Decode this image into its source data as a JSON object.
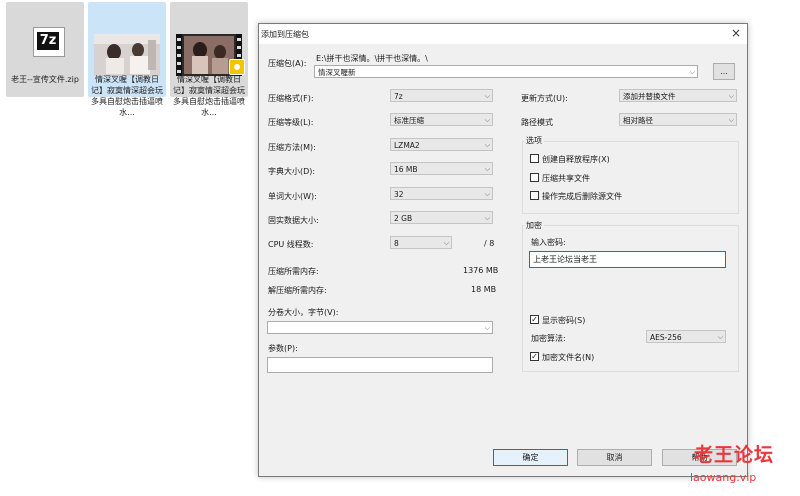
{
  "desktop": {
    "items": [
      {
        "label": "老王--宣传文件.zip",
        "icon": "7z-archive-icon"
      },
      {
        "label": "情深叉喔【调教日记】寂寞情深超会玩 多具自慰炮击插逼喷水...",
        "icon": "video-thumbnail"
      },
      {
        "label": "情深叉喔【调教日记】寂寞情深超会玩 多具自慰炮击插逼喷水...",
        "icon": "video-thumbnail"
      }
    ]
  },
  "dialog": {
    "title": "添加到压缩包",
    "close_icon": "×",
    "archive": {
      "label": "压缩包(A):",
      "path": "E:\\拼干也深情。\\拼干也深情。\\",
      "value": "情深叉喔新",
      "browse_label": "..."
    },
    "format": {
      "label": "压缩格式(F):",
      "value": "7z"
    },
    "level": {
      "label": "压缩等级(L):",
      "value": "标准压缩"
    },
    "method": {
      "label": "压缩方法(M):",
      "value": "LZMA2"
    },
    "dict": {
      "label": "字典大小(D):",
      "value": "16 MB"
    },
    "word": {
      "label": "单词大小(W):",
      "value": "32"
    },
    "solid": {
      "label": "固实数据大小:",
      "value": "2 GB"
    },
    "cpu": {
      "label": "CPU 线程数:",
      "value": "8",
      "total": "/ 8"
    },
    "mem_comp": {
      "label": "压缩所需内存:",
      "value": "1376 MB"
    },
    "mem_decomp": {
      "label": "解压缩所需内存:",
      "value": "18 MB"
    },
    "split": {
      "label": "分卷大小，字节(V):",
      "value": ""
    },
    "params": {
      "label": "参数(P):",
      "value": ""
    },
    "update": {
      "label": "更新方式(U):",
      "value": "添加并替换文件"
    },
    "path_mode": {
      "label": "路径模式",
      "value": "相对路径"
    },
    "options": {
      "title": "选项",
      "items": [
        {
          "label": "创建自释放程序(X)",
          "checked": false
        },
        {
          "label": "压缩共享文件",
          "checked": false
        },
        {
          "label": "操作完成后删除源文件",
          "checked": false
        }
      ]
    },
    "encryption": {
      "title": "加密",
      "password_label": "输入密码:",
      "password": "上老王论坛当老王",
      "show_password": {
        "label": "显示密码(S)",
        "checked": true
      },
      "method_label": "加密算法:",
      "method_value": "AES-256",
      "encrypt_names": {
        "label": "加密文件名(N)",
        "checked": true
      }
    },
    "buttons": {
      "ok": "确定",
      "cancel": "取消",
      "help": "帮助"
    }
  },
  "watermark": {
    "line1": "老王论坛",
    "line2": "laowang.vip"
  },
  "colors": {
    "accent": "#0078d7",
    "watermark": "#e8383d",
    "selection": "#cce4f7"
  }
}
